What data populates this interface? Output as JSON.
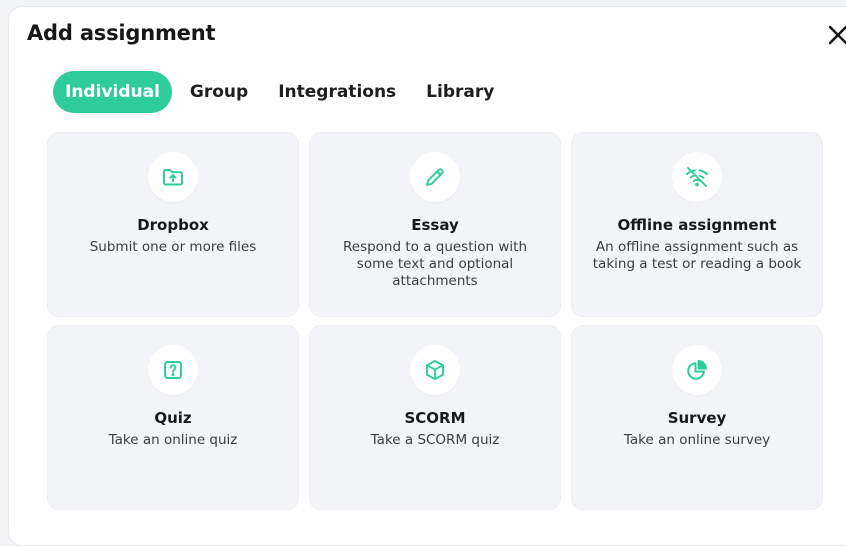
{
  "dialog": {
    "title": "Add assignment"
  },
  "tabs": [
    {
      "label": "Individual",
      "active": true
    },
    {
      "label": "Group",
      "active": false
    },
    {
      "label": "Integrations",
      "active": false
    },
    {
      "label": "Library",
      "active": false
    }
  ],
  "cards": [
    {
      "title": "Dropbox",
      "description": "Submit one or more files",
      "icon": "folder-upload-icon"
    },
    {
      "title": "Essay",
      "description": "Respond to a question with some text and optional attachments",
      "icon": "pencil-icon"
    },
    {
      "title": "Offline assignment",
      "description": "An offline assignment such as taking a test or reading a book",
      "icon": "wifi-off-icon"
    },
    {
      "title": "Quiz",
      "description": "Take an online quiz",
      "icon": "question-box-icon"
    },
    {
      "title": "SCORM",
      "description": "Take a SCORM quiz",
      "icon": "cube-icon"
    },
    {
      "title": "Survey",
      "description": "Take an online survey",
      "icon": "pie-chart-icon"
    }
  ],
  "colors": {
    "accent": "#2ecc9b",
    "card_background": "#f3f4f7",
    "text": "#18191b"
  }
}
